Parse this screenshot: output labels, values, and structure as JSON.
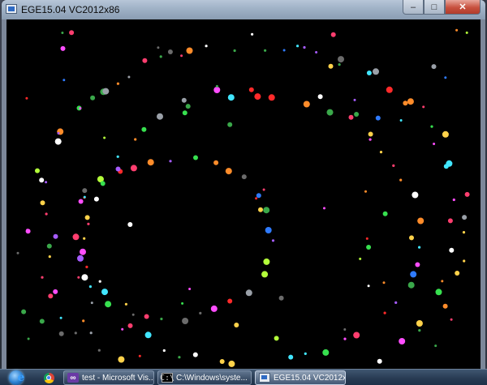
{
  "window": {
    "title": "EGE15.04 VC2012x86",
    "controls": {
      "minimize": "–",
      "maximize": "□",
      "close": "✕"
    }
  },
  "canvas": {
    "description_colors": [
      "#ff3e6f",
      "#37e04f",
      "#2f7bff",
      "#ff4dff",
      "#41e6ff",
      "#ffffff",
      "#ffd24a",
      "#ff8c2a",
      "#a65cff",
      "#9aa0a8",
      "#3aa84a",
      "#6b6b6b",
      "#b3ff3a",
      "#ff2a2a"
    ]
  },
  "taskbar": {
    "pinned": [
      {
        "name": "internet-explorer-icon",
        "glyph": "e"
      },
      {
        "name": "chrome-icon",
        "glyph": ""
      }
    ],
    "tasks": [
      {
        "label": "test - Microsoft Vis...",
        "icon": "visual-studio-icon",
        "glyph": "∞",
        "active": false
      },
      {
        "label": "C:\\Windows\\syste...",
        "icon": "cmd-icon",
        "glyph": "C:\\",
        "active": false
      },
      {
        "label": "EGE15.04 VC2012x...",
        "icon": "ege-app-icon",
        "glyph": "",
        "active": true
      }
    ]
  }
}
